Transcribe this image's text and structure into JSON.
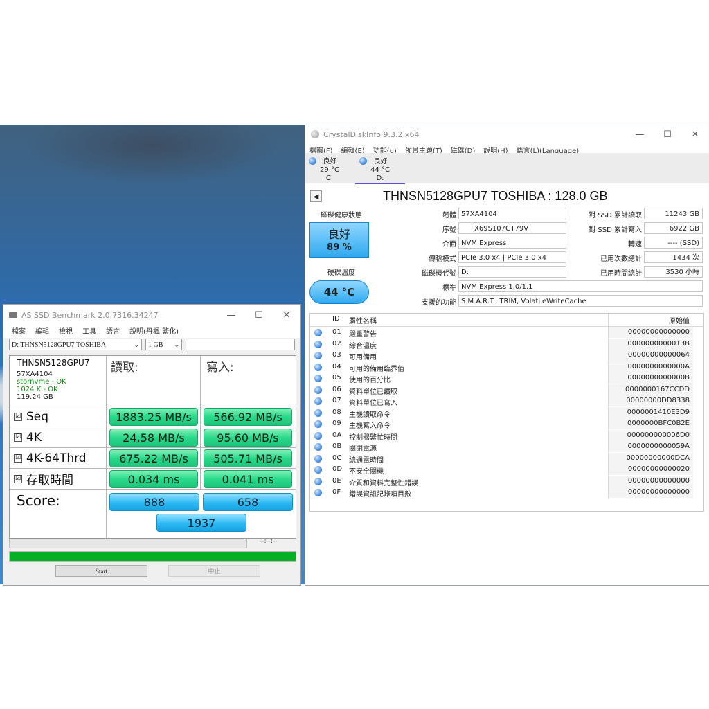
{
  "asssd": {
    "title": "AS SSD Benchmark 2.0.7316.34247",
    "menu": [
      "檔案",
      "編輯",
      "檢視",
      "工具",
      "語言",
      "說明(丹楓 繁化)"
    ],
    "drive_select": "D: THNSN5128GPU7 TOSHIBA",
    "size_select": "1 GB",
    "info": {
      "model": "THNSN5128GPU7",
      "firmware": "57XA4104",
      "driver": "stornvme - OK",
      "align": "1024 K - OK",
      "capacity": "119.24 GB"
    },
    "read_header": "讀取:",
    "write_header": "寫入:",
    "rows": [
      {
        "label": "Seq",
        "read": "1883.25 MB/s",
        "write": "566.92 MB/s"
      },
      {
        "label": "4K",
        "read": "24.58 MB/s",
        "write": "95.60 MB/s"
      },
      {
        "label": "4K-64Thrd",
        "read": "675.22 MB/s",
        "write": "505.71 MB/s"
      },
      {
        "label": "存取時間",
        "read": "0.034 ms",
        "write": "0.041 ms"
      }
    ],
    "check_glyph": "☑",
    "score_label": "Score:",
    "score_read": "888",
    "score_write": "658",
    "score_total": "1937",
    "progress_time": "--:--:--",
    "progress_value": 1.0,
    "start_label": "Start",
    "stop_label": "中止"
  },
  "cdi": {
    "title": "CrystalDiskInfo 9.3.2 x64",
    "menu": [
      "檔案(F)",
      "編輯(E)",
      "功能(u)",
      "佈景主題(T)",
      "磁碟(D)",
      "說明(H)",
      "語言(L)(Language)"
    ],
    "drives": [
      {
        "status": "良好",
        "temp": "29 °C",
        "letter": "C:"
      },
      {
        "status": "良好",
        "temp": "44 °C",
        "letter": "D:"
      }
    ],
    "disk_title": "THNSN5128GPU7 TOSHIBA : 128.0 GB",
    "health_label": "磁碟健康狀態",
    "health_status": "良好",
    "health_percent": "89 %",
    "temp_label": "硬碟溫度",
    "temp_value": "44 °C",
    "fields": [
      {
        "label": "韌體",
        "value": "57XA4104"
      },
      {
        "label": "序號",
        "value": "X69S107GT79V"
      },
      {
        "label": "介面",
        "value": "NVM Express"
      },
      {
        "label": "傳輸模式",
        "value": "PCIe 3.0 x4 | PCIe 3.0 x4"
      },
      {
        "label": "磁碟機代號",
        "value": "D:"
      },
      {
        "label": "標準",
        "value": "NVM Express 1.0/1.1"
      },
      {
        "label": "支援的功能",
        "value": "S.M.A.R.T., TRIM, VolatileWriteCache"
      }
    ],
    "right_fields": [
      {
        "label": "對 SSD 累計讀取",
        "value": "11243 GB"
      },
      {
        "label": "對 SSD 累計寫入",
        "value": "6922 GB"
      },
      {
        "label": "轉速",
        "value": "---- (SSD)"
      },
      {
        "label": "已用次數總計",
        "value": "1434 次"
      },
      {
        "label": "已用時間總計",
        "value": "3530 小時"
      }
    ],
    "smart_headers": {
      "id": "ID",
      "name": "屬性名稱",
      "raw": "原始值"
    },
    "smart": [
      {
        "id": "01",
        "name": "嚴重警告",
        "raw": "00000000000000"
      },
      {
        "id": "02",
        "name": "綜合溫度",
        "raw": "0000000000013B"
      },
      {
        "id": "03",
        "name": "可用備用",
        "raw": "00000000000064"
      },
      {
        "id": "04",
        "name": "可用的備用臨界值",
        "raw": "0000000000000A"
      },
      {
        "id": "05",
        "name": "使用的百分比",
        "raw": "0000000000000B"
      },
      {
        "id": "06",
        "name": "資料單位已讀取",
        "raw": "0000000167CCDD"
      },
      {
        "id": "07",
        "name": "資料單位已寫入",
        "raw": "00000000DD8338"
      },
      {
        "id": "08",
        "name": "主機讀取命令",
        "raw": "0000001410E3D9"
      },
      {
        "id": "09",
        "name": "主機寫入命令",
        "raw": "0000000BFC0B2E"
      },
      {
        "id": "0A",
        "name": "控制器繁忙時間",
        "raw": "000000000006D0"
      },
      {
        "id": "0B",
        "name": "關閉電源",
        "raw": "0000000000059A"
      },
      {
        "id": "0C",
        "name": "總通電時間",
        "raw": "00000000000DCA"
      },
      {
        "id": "0D",
        "name": "不安全關機",
        "raw": "00000000000020"
      },
      {
        "id": "0E",
        "name": "介質和資料完整性錯誤",
        "raw": "00000000000000"
      },
      {
        "id": "0F",
        "name": "錯誤資訊記錄項目數",
        "raw": "00000000000000"
      }
    ]
  }
}
